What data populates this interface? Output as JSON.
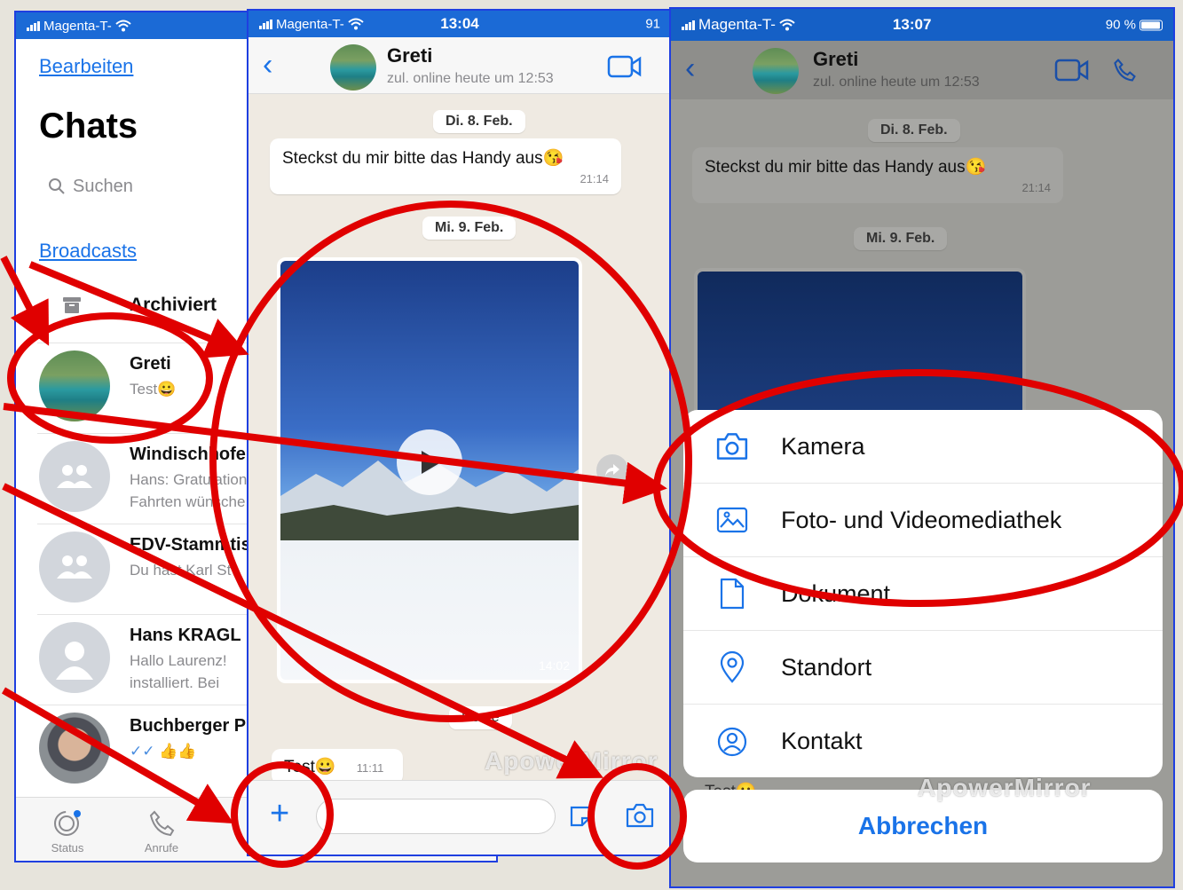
{
  "phone_left": {
    "status": {
      "carrier": "Magenta-T-"
    },
    "edit_label": "Bearbeiten",
    "title": "Chats",
    "search_placeholder": "Suchen",
    "broadcasts_label": "Broadcasts",
    "archived_label": "Archiviert",
    "chats": [
      {
        "name": "Greti",
        "preview": "Test😀"
      },
      {
        "name": "Windischhofer",
        "preview": "Hans: Gratulation\nFahrten wünsche"
      },
      {
        "name": "EDV-Stammtisch",
        "preview": "Du hast Karl St"
      },
      {
        "name": "Hans KRAGL",
        "preview": "Hallo Laurenz!\ninstalliert.  Bei"
      },
      {
        "name": "Buchberger P",
        "preview": "✓✓ 👍👍"
      }
    ],
    "tabs": {
      "status": "Status",
      "calls": "Anrufe"
    }
  },
  "phone_middle": {
    "status": {
      "carrier": "Magenta-T-",
      "time": "13:04",
      "battery": "91"
    },
    "contact_name": "Greti",
    "last_seen": "zul. online heute um 12:53",
    "date1": "Di. 8. Feb.",
    "message1": {
      "text": "Steckst du mir bitte das Handy aus😘",
      "time": "21:14"
    },
    "date2": "Mi. 9. Feb.",
    "video_duration": "14:02",
    "date3": "Heute",
    "message2": {
      "text": "Test😀",
      "time": "11:11"
    },
    "watermark": "ApowerMirror"
  },
  "phone_right": {
    "status": {
      "carrier": "Magenta-T-",
      "time": "13:07",
      "battery": "90 %"
    },
    "contact_name": "Greti",
    "last_seen": "zul. online heute um 12:53",
    "date1": "Di. 8. Feb.",
    "message1": {
      "text": "Steckst du mir bitte das Handy aus😘",
      "time": "21:14"
    },
    "date2": "Mi. 9. Feb.",
    "sheet_items": [
      {
        "label": "Kamera",
        "icon": "camera-icon"
      },
      {
        "label": "Foto- und Videomediathek",
        "icon": "photo-library-icon"
      },
      {
        "label": "Dokument",
        "icon": "document-icon"
      },
      {
        "label": "Standort",
        "icon": "location-icon"
      },
      {
        "label": "Kontakt",
        "icon": "contact-icon"
      }
    ],
    "peek_text": "Test😀",
    "cancel_label": "Abbrechen",
    "watermark": "ApowerMirror"
  },
  "colors": {
    "accent": "#1a73e8",
    "annotation": "#e00000",
    "frame": "#1f3fe0"
  }
}
